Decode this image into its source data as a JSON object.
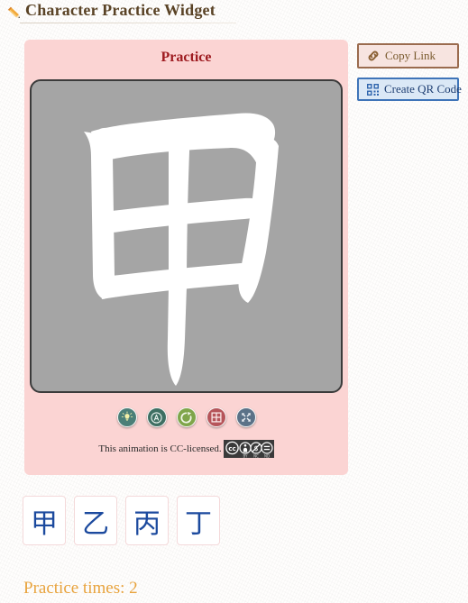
{
  "header": {
    "title": "Character Practice Widget",
    "pencil_icon": "pencil-icon"
  },
  "practice_panel": {
    "heading": "Practice",
    "character": "甲",
    "canvas_bg": "#a5a5a5",
    "stroke_color": "#ffffff",
    "panel_bg": "#fbd4d3",
    "controls": [
      {
        "name": "hint-button",
        "icon": "lightbulb-icon",
        "color": "#4c7f78",
        "title": "Hint"
      },
      {
        "name": "animate-button",
        "icon": "circled-a-icon",
        "color": "#3f6f63",
        "title": "Animate"
      },
      {
        "name": "replay-button",
        "icon": "refresh-icon",
        "color": "#7fa54a",
        "title": "Replay"
      },
      {
        "name": "grid-button",
        "icon": "grid-icon",
        "color": "#b6555a",
        "title": "Grid"
      },
      {
        "name": "fullscreen-button",
        "icon": "fullscreen-icon",
        "color": "#5b7288",
        "title": "Fullscreen"
      }
    ],
    "license_text": "This animation is CC-licensed.",
    "license_badge": {
      "marks": [
        "cc",
        "BY",
        "NC",
        "ND"
      ]
    }
  },
  "side_buttons": {
    "copy_link": {
      "label": "Copy Link",
      "icon": "link-icon",
      "border_color": "#9a6b4e",
      "fill_color": "#f7e4e0"
    },
    "create_qr": {
      "label": "Create QR Code",
      "icon": "qr-code-icon",
      "border_color": "#3f74b8",
      "fill_color": "#dbe8f6"
    }
  },
  "character_tiles": [
    {
      "char": "甲"
    },
    {
      "char": "乙"
    },
    {
      "char": "丙"
    },
    {
      "char": "丁"
    }
  ],
  "footer": {
    "practice_times_label": "Practice times: 2",
    "color": "#e8a33d"
  }
}
